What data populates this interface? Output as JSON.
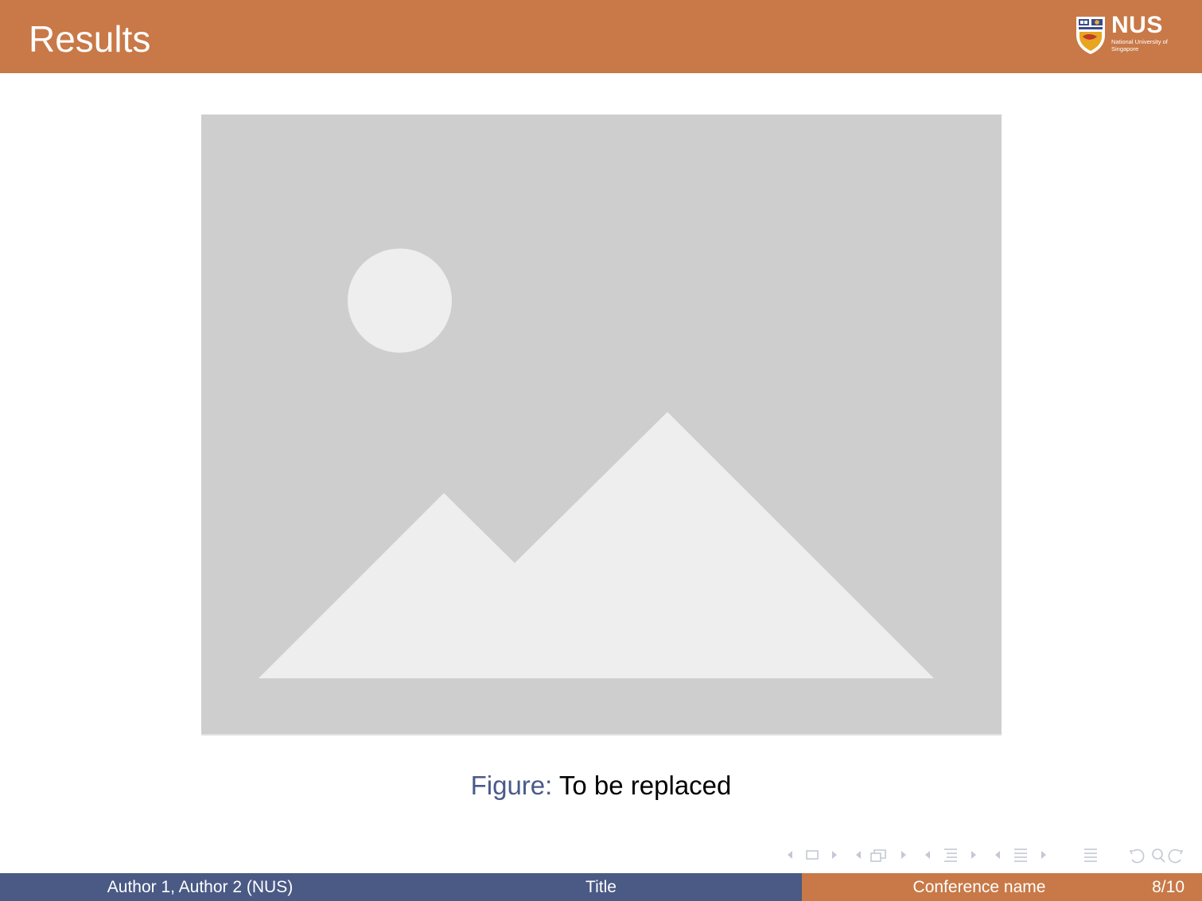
{
  "header": {
    "title": "Results",
    "logo": {
      "word": "NUS",
      "subtitle": "National University of Singapore"
    }
  },
  "figure": {
    "placeholder_icon": "image-placeholder-icon",
    "caption_prefix": "Figure:",
    "caption_text": "To be replaced"
  },
  "nav": {
    "icons": [
      "slide-prev-icon",
      "slide-frame-icon",
      "slide-next-icon",
      "frame-prev-icon",
      "frames-icon",
      "frame-next-icon",
      "subsection-prev-icon",
      "subsection-icon",
      "subsection-next-icon",
      "section-prev-icon",
      "section-icon",
      "section-next-icon",
      "toc-icon",
      "undo-icon",
      "search-icon",
      "redo-icon"
    ]
  },
  "footer": {
    "authors": "Author 1, Author 2  (NUS)",
    "title": "Title",
    "conference": "Conference name",
    "page": "8/10"
  },
  "colors": {
    "header_bg": "#c87947",
    "footer_blue": "#4a5a85",
    "footer_orange": "#c87947",
    "caption_prefix": "#4a5a8a",
    "placeholder_bg": "#cecece",
    "placeholder_shape": "#eeeeee"
  }
}
